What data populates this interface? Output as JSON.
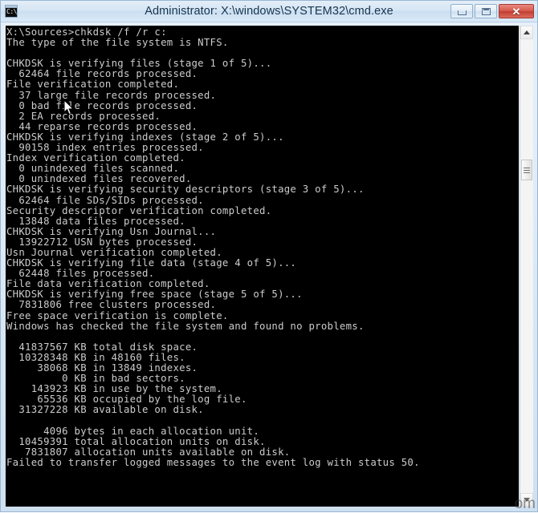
{
  "window": {
    "title": "Administrator: X:\\windows\\SYSTEM32\\cmd.exe",
    "icon_label": "C:\\",
    "icon_name": "cmd-console-icon",
    "controls": {
      "minimize_label": "Minimize",
      "maximize_label": "Maximize",
      "close_label": "✕"
    },
    "colors": {
      "titlebar_top": "#e4eef8",
      "titlebar_bottom": "#d9e9f7",
      "frame": "#cfe0f0",
      "close_button": "#c13d31",
      "console_background": "#000000",
      "console_foreground": "#cccccc"
    }
  },
  "console": {
    "prompt": "X:\\Sources>",
    "command": "chkdsk /f /r c:",
    "lines": [
      "X:\\Sources>chkdsk /f /r c:",
      "The type of the file system is NTFS.",
      "",
      "CHKDSK is verifying files (stage 1 of 5)...",
      "  62464 file records processed.",
      "File verification completed.",
      "  37 large file records processed.",
      "  0 bad file records processed.",
      "  2 EA records processed.",
      "  44 reparse records processed.",
      "CHKDSK is verifying indexes (stage 2 of 5)...",
      "  90158 index entries processed.",
      "Index verification completed.",
      "  0 unindexed files scanned.",
      "  0 unindexed files recovered.",
      "CHKDSK is verifying security descriptors (stage 3 of 5)...",
      "  62464 file SDs/SIDs processed.",
      "Security descriptor verification completed.",
      "  13848 data files processed.",
      "CHKDSK is verifying Usn Journal...",
      "  13922712 USN bytes processed.",
      "Usn Journal verification completed.",
      "CHKDSK is verifying file data (stage 4 of 5)...",
      "  62448 files processed.",
      "File data verification completed.",
      "CHKDSK is verifying free space (stage 5 of 5)...",
      "  7831806 free clusters processed.",
      "Free space verification is complete.",
      "Windows has checked the file system and found no problems.",
      "",
      "  41837567 KB total disk space.",
      "  10328348 KB in 48160 files.",
      "     38068 KB in 13849 indexes.",
      "         0 KB in bad sectors.",
      "    143923 KB in use by the system.",
      "     65536 KB occupied by the log file.",
      "  31327228 KB available on disk.",
      "",
      "      4096 bytes in each allocation unit.",
      "  10459391 total allocation units on disk.",
      "   7831807 allocation units available on disk.",
      "Failed to transfer logged messages to the event log with status 50."
    ]
  },
  "scrollbar": {
    "up_arrow": "▲",
    "down_arrow": "▼",
    "thumb_label": "scroll-thumb"
  },
  "watermark": {
    "text": "om"
  }
}
